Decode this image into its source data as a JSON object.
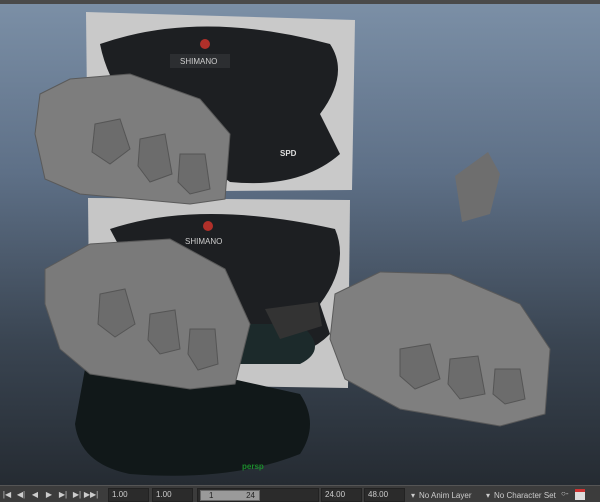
{
  "viewport": {
    "camera_label": "persp",
    "texture_logos": [
      "SHIMANO",
      "SPD"
    ]
  },
  "timebar": {
    "playback_buttons": [
      {
        "name": "go-to-start",
        "glyph": "|◀"
      },
      {
        "name": "step-back",
        "glyph": "◀|"
      },
      {
        "name": "play-back",
        "glyph": "◀"
      },
      {
        "name": "play-forward",
        "glyph": "▶"
      },
      {
        "name": "step-forward",
        "glyph": "▶|"
      },
      {
        "name": "step-key-forward",
        "glyph": "▶|"
      },
      {
        "name": "go-to-end",
        "glyph": "▶▶|"
      }
    ],
    "start_time": "1.00",
    "playback_start": "1.00",
    "range_start": "1",
    "range_end": "24",
    "playback_end": "24.00",
    "end_time": "48.00",
    "anim_layer": "No Anim Layer",
    "character_set": "No Character Set"
  }
}
